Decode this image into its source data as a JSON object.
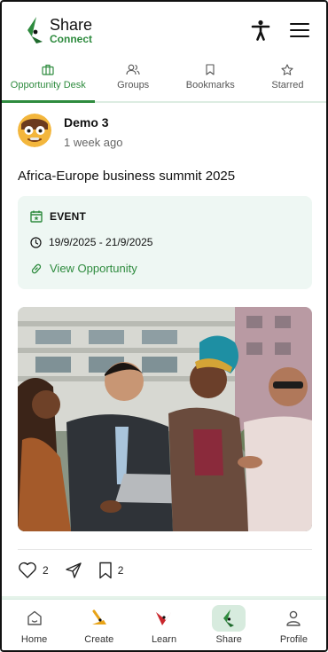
{
  "app": {
    "logo_line1": "Share",
    "logo_line2": "Connect",
    "brand_color": "#2e8b3e"
  },
  "header": {
    "icons": [
      "accessibility-icon",
      "menu-icon"
    ]
  },
  "tabs": [
    {
      "label": "Opportunity Desk",
      "icon": "briefcase-icon",
      "active": true
    },
    {
      "label": "Groups",
      "icon": "users-icon",
      "active": false
    },
    {
      "label": "Bookmarks",
      "icon": "bookmark-icon",
      "active": false
    },
    {
      "label": "Starred",
      "icon": "star-icon",
      "active": false
    }
  ],
  "post": {
    "author": "Demo 3",
    "time": "1 week ago",
    "title": "Africa-Europe business summit 2025",
    "event": {
      "type": "EVENT",
      "dates": "19/9/2025 - 21/9/2025",
      "link": "View Opportunity"
    },
    "likes": "2",
    "bookmarks": "2"
  },
  "bottom_nav": [
    {
      "label": "Home",
      "icon": "home-icon",
      "active": false
    },
    {
      "label": "Create",
      "icon": "create-icon",
      "active": false
    },
    {
      "label": "Learn",
      "icon": "learn-icon",
      "active": false
    },
    {
      "label": "Share",
      "icon": "share-logo-icon",
      "active": true
    },
    {
      "label": "Profile",
      "icon": "profile-icon",
      "active": false
    }
  ]
}
